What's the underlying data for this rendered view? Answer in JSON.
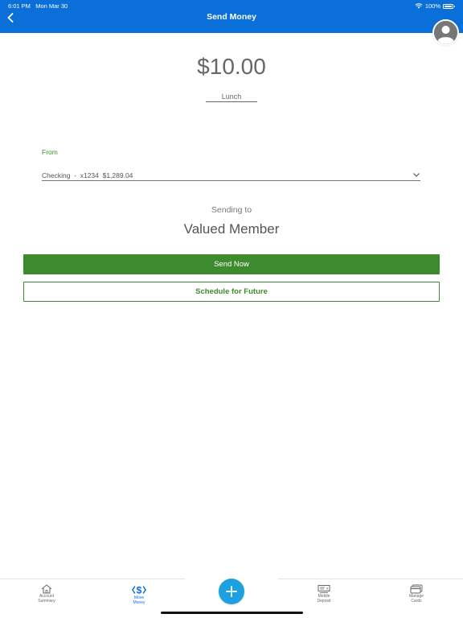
{
  "status_bar": {
    "time": "6:01 PM",
    "date": "Mon Mar 30",
    "battery": "100%"
  },
  "header": {
    "title": "Send Money"
  },
  "transfer": {
    "amount": "$10.00",
    "memo": "Lunch"
  },
  "from": {
    "label": "From",
    "account": "Checking  -  x1234  $1,289.04"
  },
  "recipient": {
    "sending_to_label": "Sending to",
    "name": "Valued Member"
  },
  "actions": {
    "send_now": "Send Now",
    "schedule": "Schedule for Future"
  },
  "tabbar": {
    "account_summary": [
      "Account",
      "Summary"
    ],
    "move_money": [
      "Move",
      "Money"
    ],
    "mobile_deposit": [
      "Mobile",
      "Deposit"
    ],
    "manage_cards": [
      "Manage",
      "Cards"
    ]
  },
  "colors": {
    "header_blue": "#0a6fd8",
    "accent_green": "#3e8a2e",
    "fab_blue": "#1ea0de"
  },
  "icons": [
    "chevron-left-icon",
    "wifi-icon",
    "battery-icon",
    "user-avatar-icon",
    "chevron-down-icon",
    "home-icon",
    "dollar-transfer-icon",
    "plus-icon",
    "check-deposit-icon",
    "card-icon"
  ]
}
